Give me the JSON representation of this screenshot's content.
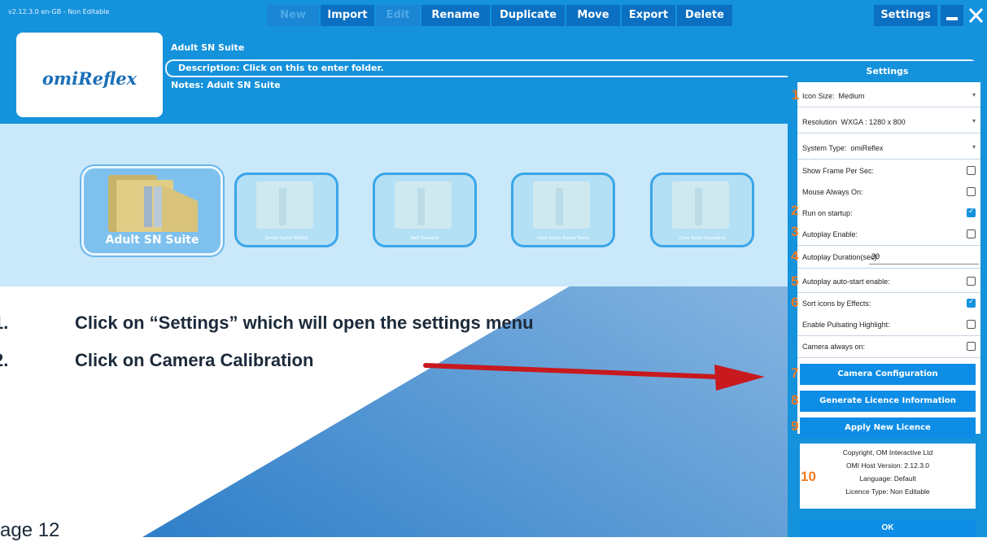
{
  "app": {
    "version_text": "v2.12.3.0 en-GB - Non Editable"
  },
  "menu": {
    "new": "New",
    "import": "Import",
    "edit": "Edit",
    "rename": "Rename",
    "duplicate": "Duplicate",
    "move": "Move",
    "export": "Export",
    "delete": "Delete",
    "settings": "Settings"
  },
  "window": {
    "minimize_icon": "minimize-icon",
    "close_icon": "close-icon"
  },
  "header": {
    "logo_text": "omiReflex",
    "title": "Adult SN Suite",
    "description": "Description: Click on this to enter folder.",
    "notes": "Notes: Adult SN Suite"
  },
  "folders": [
    {
      "label": "Adult SN Suite",
      "active": true
    },
    {
      "label": "Junior Suite WXGA",
      "active": false
    },
    {
      "label": "Ball Camera",
      "active": false
    },
    {
      "label": "Core Suite Demo Tests",
      "active": false
    },
    {
      "label": "Core Suite Standard",
      "active": false
    }
  ],
  "instructions": [
    {
      "num": "1.",
      "text": "Click on “Settings” which will open the settings menu"
    },
    {
      "num": "2.",
      "text": "Click on Camera Calibration"
    }
  ],
  "page_label": "age 12",
  "settings": {
    "title": "Settings",
    "icon_size_label": "Icon Size:",
    "icon_size_value": "Medium",
    "resolution_label": "Resolution",
    "resolution_value": "WXGA : 1280 x 800",
    "system_type_label": "System Type:",
    "system_type_value": "omiReflex",
    "show_fps": "Show Frame Per Sec:",
    "mouse_always_on": "Mouse Always On:",
    "run_on_startup": "Run on startup:",
    "autoplay_enable": "Autoplay Enable:",
    "autoplay_duration": "Autoplay Duration(sec):",
    "autoplay_duration_value": "30",
    "autoplay_autostart": "Autoplay auto-start enable:",
    "sort_icons": "Sort icons by Effects:",
    "pulsating": "Enable Pulsating Highlight:",
    "camera_always_on": "Camera always on:",
    "camera_config": "Camera Configuration",
    "generate_licence": "Generate Licence Information",
    "apply_licence": "Apply New Licence",
    "info": {
      "copyright": "Copyright, OM Interactive Ltd",
      "host_version": "OMI Host Version: 2.12.3.0",
      "language": "Language: Default",
      "licence_type": "Licence Type: Non Editable"
    },
    "ok": "OK"
  },
  "checkbox_states": {
    "show_fps": false,
    "mouse_always_on": false,
    "run_on_startup": true,
    "autoplay_enable": false,
    "autoplay_autostart": false,
    "sort_icons": true,
    "pulsating": false,
    "camera_always_on": false
  },
  "callouts": [
    "1",
    "2",
    "3",
    "4",
    "5",
    "6",
    "7",
    "8",
    "9",
    "10"
  ],
  "colors": {
    "app_blue": "#1592dc",
    "button_blue": "#0b6fc2",
    "callout_orange": "#f47a20",
    "arrow_red": "#c8191f"
  }
}
